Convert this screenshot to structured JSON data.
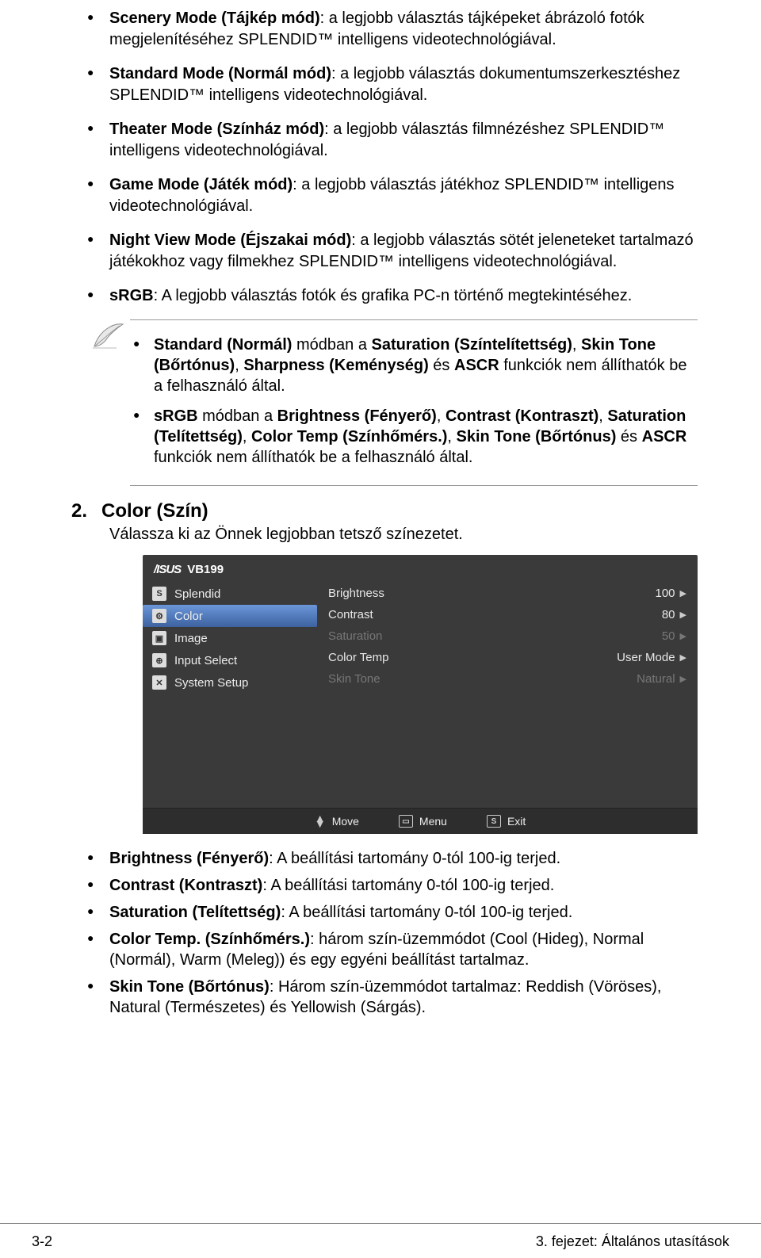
{
  "bullets_top": [
    {
      "b": "Scenery Mode (Tájkép mód)",
      "t": ": a legjobb választás tájképeket ábrázoló fotók megjelenítéséhez SPLENDID™ intelligens videotechnológiával."
    },
    {
      "b": "Standard Mode (Normál mód)",
      "t": ": a legjobb választás dokumentumszerkesztéshez SPLENDID™ intelligens videotechnológiával."
    },
    {
      "b": "Theater Mode (Színház mód)",
      "t": ": a legjobb választás filmnézéshez SPLENDID™ intelligens videotechnológiával."
    },
    {
      "b": "Game Mode (Játék mód)",
      "t": ": a legjobb választás játékhoz SPLENDID™ intelligens videotechnológiával."
    },
    {
      "b": "Night View Mode (Éjszakai mód)",
      "t": ": a legjobb választás sötét jeleneteket tartalmazó játékokhoz vagy filmekhez SPLENDID™ intelligens videotechnológiával."
    },
    {
      "b": "sRGB",
      "t": ": A legjobb választás fotók és grafika PC-n történő megtekintéséhez."
    }
  ],
  "note1_html": "<b>Standard (Normál)</b> módban a <b>Saturation (Színtelítettség)</b>, <b>Skin Tone (Bőrtónus)</b>, <b>Sharpness (Keménység)</b> és <b>ASCR</b> funkciók nem állíthatók be a felhasználó által.",
  "note2_html": "<b>sRGB</b> módban a <b>Brightness (Fényerő)</b>, <b>Contrast (Kontraszt)</b>, <b>Saturation (Telítettség)</b>, <b>Color Temp (Színhőmérs.)</b>, <b>Skin Tone (Bőrtónus)</b> és <b>ASCR</b> funkciók nem állíthatók be a felhasználó által.",
  "section": {
    "num": "2.",
    "title": "Color (Szín)",
    "sub": "Válassza ki az Önnek legjobban tetsző színezetet."
  },
  "osd": {
    "model": "VB199",
    "menu": [
      {
        "icon": "S",
        "label": "Splendid"
      },
      {
        "icon": "⚙",
        "label": "Color",
        "sel": true
      },
      {
        "icon": "▣",
        "label": "Image"
      },
      {
        "icon": "⊕",
        "label": "Input Select"
      },
      {
        "icon": "✕",
        "label": "System Setup"
      }
    ],
    "opts": [
      {
        "label": "Brightness",
        "value": "100"
      },
      {
        "label": "Contrast",
        "value": "80"
      },
      {
        "label": "Saturation",
        "value": "50",
        "dis": true
      },
      {
        "label": "Color Temp",
        "value": "User Mode"
      },
      {
        "label": "Skin Tone",
        "value": "Natural",
        "dis": true
      }
    ],
    "footer": {
      "move": "Move",
      "menu": "Menu",
      "exit": "Exit"
    }
  },
  "bullets_bottom": [
    {
      "b": "Brightness (Fényerő)",
      "t": ": A beállítási tartomány 0-tól 100-ig terjed."
    },
    {
      "b": "Contrast (Kontraszt)",
      "t": ": A beállítási tartomány 0-tól 100-ig terjed."
    },
    {
      "b": "Saturation (Telítettség)",
      "t": ": A beállítási tartomány 0-tól 100-ig terjed."
    },
    {
      "b": "Color Temp. (Színhőmérs.)",
      "t": ": három szín-üzemmódot (Cool (Hideg), Normal (Normál), Warm (Meleg)) és egy egyéni beállítást tartalmaz."
    },
    {
      "b": "Skin Tone (Bőrtónus)",
      "t": ": Három szín-üzemmódot tartalmaz: Reddish (Vöröses), Natural (Természetes) és Yellowish (Sárgás)."
    }
  ],
  "footer": {
    "left": "3-2",
    "right": "3. fejezet: Általános utasítások"
  }
}
